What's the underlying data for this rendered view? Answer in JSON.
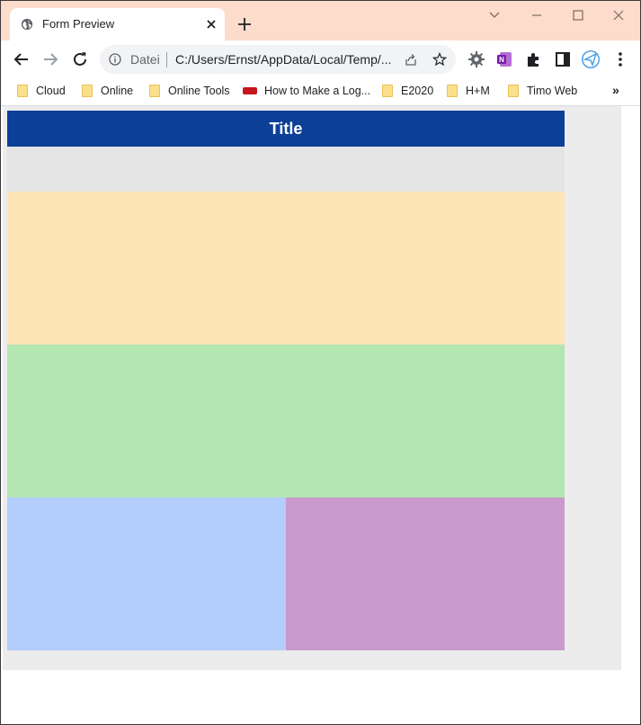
{
  "browser": {
    "tab": {
      "title": "Form Preview"
    },
    "omnibox": {
      "security_label": "Datei",
      "url": "C:/Users/Ernst/AppData/Local/Temp/..."
    },
    "bookmarks": [
      {
        "label": "Cloud",
        "icon": "folder-icon"
      },
      {
        "label": "Online",
        "icon": "folder-icon"
      },
      {
        "label": "Online Tools",
        "icon": "folder-icon"
      },
      {
        "label": "How to Make a Log...",
        "icon": "site-logo-icon"
      },
      {
        "label": "E2020",
        "icon": "folder-icon"
      },
      {
        "label": "H+M",
        "icon": "folder-icon"
      },
      {
        "label": "Timo Web",
        "icon": "folder-icon"
      }
    ],
    "bookmarks_more": "»",
    "colors": {
      "tabstrip": "#fddccb",
      "omnibox": "#f1f3f4"
    }
  },
  "form": {
    "title": "Title",
    "colors": {
      "title_bar": "#0c3f96",
      "row1": "#e4e4e4",
      "row2": "#fee5b5",
      "row3": "#b4e6b2",
      "row4_left": "#b3cdfd",
      "row4_right": "#cb9acc",
      "page_background": "#ececec"
    }
  }
}
